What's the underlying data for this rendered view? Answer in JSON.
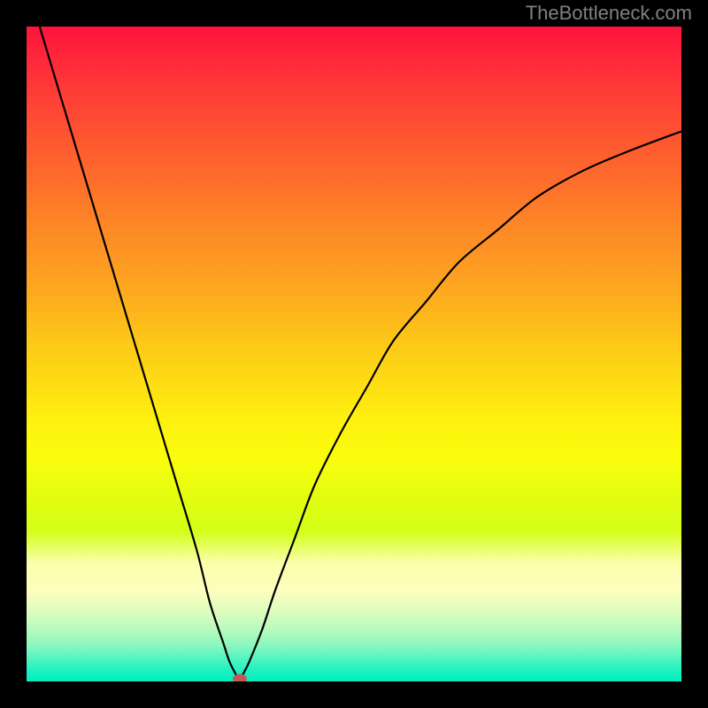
{
  "watermark": "TheBottleneck.com",
  "chart_data": {
    "type": "line",
    "title": "",
    "xlabel": "",
    "ylabel": "",
    "xlim": [
      0,
      100
    ],
    "ylim": [
      0,
      100
    ],
    "grid": false,
    "series": [
      {
        "name": "bottleneck-curve",
        "x": [
          2,
          5,
          8,
          11,
          14,
          17,
          20,
          23,
          26,
          28,
          30,
          31,
          32,
          32.5,
          33,
          34,
          36,
          38,
          41,
          44,
          48,
          52,
          56,
          61,
          66,
          72,
          78,
          85,
          92,
          100
        ],
        "y": [
          100,
          90,
          80,
          70,
          60,
          50,
          40,
          30,
          20,
          12,
          6,
          3,
          1,
          0,
          1,
          3,
          8,
          14,
          22,
          30,
          38,
          45,
          52,
          58,
          64,
          69,
          74,
          78,
          81,
          84
        ]
      }
    ],
    "marker": {
      "x": 32.5,
      "y": 0,
      "color": "#c15a56"
    },
    "background_gradient": {
      "top": "#fe133d",
      "mid": "#fdf10e",
      "bottom": "#00efc1"
    }
  }
}
